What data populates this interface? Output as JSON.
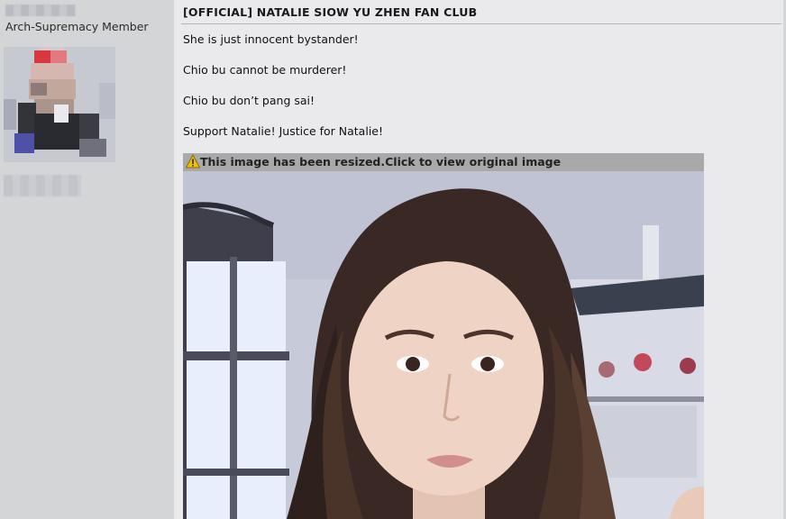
{
  "user": {
    "rank": "Arch-Supremacy Member"
  },
  "post": {
    "title": "[OFFICIAL] NATALIE SIOW YU ZHEN FAN CLUB",
    "lines": [
      "She is just innocent bystander!",
      "Chio bu cannot be murderer!",
      "Chio bu don’t pang sai!",
      "Support Natalie! Justice for Natalie!"
    ],
    "resize_notice": "This image has been resized.Click to view original image",
    "notice_icon": "warning-icon"
  },
  "colors": {
    "sidebar_bg": "#d4d5d7",
    "post_bg": "#eaeaec",
    "notice_bar": "#a9a9a9",
    "warning": "#f2c200"
  }
}
